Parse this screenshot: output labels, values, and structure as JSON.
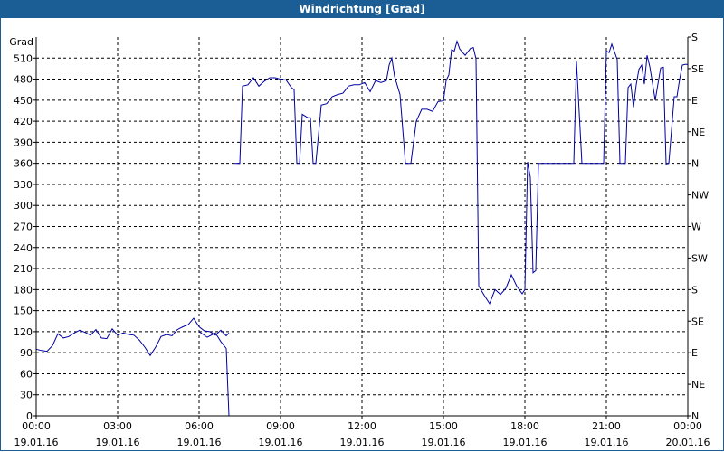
{
  "window": {
    "title": "Windrichtung [Grad]"
  },
  "colors": {
    "titlebar": "#1b5e95",
    "series": "#0000a0",
    "grid": "#000000"
  },
  "chart_data": {
    "type": "line",
    "title": "Windrichtung [Grad]",
    "ylabel": "Grad",
    "xlabel": "",
    "ylim": [
      0,
      540
    ],
    "xlim_hours": [
      0,
      24
    ],
    "y_ticks": [
      0,
      30,
      60,
      90,
      120,
      150,
      180,
      210,
      240,
      270,
      300,
      330,
      360,
      390,
      420,
      450,
      480,
      510
    ],
    "right_axis_labels": [
      {
        "value": 0,
        "label": "N"
      },
      {
        "value": 45,
        "label": "NE"
      },
      {
        "value": 90,
        "label": "E"
      },
      {
        "value": 135,
        "label": "SE"
      },
      {
        "value": 180,
        "label": "S"
      },
      {
        "value": 225,
        "label": "SW"
      },
      {
        "value": 270,
        "label": "W"
      },
      {
        "value": 315,
        "label": "NW"
      },
      {
        "value": 360,
        "label": "N"
      },
      {
        "value": 405,
        "label": "NE"
      },
      {
        "value": 450,
        "label": "E"
      },
      {
        "value": 495,
        "label": "SE"
      },
      {
        "value": 540,
        "label": "S"
      }
    ],
    "x_ticks": [
      {
        "hour": 0,
        "time": "00:00",
        "date": "19.01.16"
      },
      {
        "hour": 3,
        "time": "03:00",
        "date": "19.01.16"
      },
      {
        "hour": 6,
        "time": "06:00",
        "date": "19.01.16"
      },
      {
        "hour": 9,
        "time": "09:00",
        "date": "19.01.16"
      },
      {
        "hour": 12,
        "time": "12:00",
        "date": "19.01.16"
      },
      {
        "hour": 15,
        "time": "15:00",
        "date": "19.01.16"
      },
      {
        "hour": 18,
        "time": "18:00",
        "date": "19.01.16"
      },
      {
        "hour": 21,
        "time": "21:00",
        "date": "19.01.16"
      },
      {
        "hour": 24,
        "time": "00:00",
        "date": "20.01.16"
      }
    ],
    "grid": true,
    "legend": "none",
    "series": [
      {
        "segments": [
          {
            "hours": [
              0.0,
              0.2,
              0.4,
              0.6,
              0.8,
              1.0,
              1.2,
              1.4,
              1.6,
              1.8,
              2.0,
              2.2,
              2.4,
              2.6,
              2.8,
              3.0,
              3.2,
              3.4,
              3.6,
              3.8,
              4.0,
              4.2,
              4.4,
              4.6,
              4.8,
              5.0,
              5.2,
              5.4,
              5.6,
              5.8,
              6.0,
              6.2,
              6.4,
              6.6,
              6.8,
              7.0,
              7.1
            ],
            "values": [
              95,
              93,
              92,
              100,
              117,
              111,
              113,
              118,
              122,
              119,
              115,
              123,
              111,
              110,
              124,
              115,
              118,
              116,
              115,
              108,
              98,
              86,
              98,
              113,
              116,
              114,
              123,
              127,
              130,
              139,
              127,
              121,
              120,
              115,
              122,
              114,
              118
            ]
          },
          {
            "hours": [
              6.0,
              6.3,
              6.6,
              6.8,
              7.0,
              7.1
            ],
            "values": [
              120,
              112,
              118,
              106,
              96,
              0
            ]
          },
          {
            "hours": [
              7.3,
              7.5,
              7.6,
              7.8,
              8.0,
              8.2,
              8.4,
              8.6,
              8.8,
              9.0,
              9.2,
              9.4,
              9.5,
              9.6,
              9.7,
              9.8,
              10.0,
              10.1,
              10.2,
              10.3,
              10.5,
              10.7,
              10.9,
              11.1,
              11.3,
              11.5,
              11.7,
              11.9,
              12.1,
              12.3,
              12.5,
              12.7,
              12.9,
              13.0,
              13.1,
              13.2,
              13.4,
              13.6,
              13.8,
              14.0,
              14.2,
              14.4,
              14.6,
              14.8,
              15.0,
              15.1,
              15.2,
              15.3,
              15.4,
              15.5,
              15.6,
              15.8,
              16.0,
              16.1,
              16.2,
              16.3,
              16.5,
              16.7,
              16.9,
              17.1,
              17.3,
              17.5,
              17.7,
              17.9,
              18.0,
              18.1,
              18.2,
              18.3,
              18.4,
              18.5,
              18.6,
              18.7,
              18.8,
              19.0,
              19.2,
              19.4,
              19.6,
              19.8,
              19.9,
              20.1,
              20.3,
              20.5,
              20.7,
              20.9,
              21.0,
              21.1,
              21.2,
              21.3,
              21.4,
              21.5,
              21.6,
              21.7,
              21.8,
              21.9,
              22.0,
              22.1,
              22.2,
              22.3,
              22.4,
              22.5,
              22.6,
              22.8,
              23.0,
              23.1,
              23.2,
              23.3,
              23.5,
              23.6,
              23.7,
              23.8,
              23.9,
              24.0
            ],
            "values": [
              360,
              360,
              470,
              472,
              482,
              470,
              477,
              482,
              482,
              480,
              479,
              468,
              465,
              360,
              360,
              430,
              425,
              425,
              360,
              360,
              443,
              445,
              455,
              458,
              460,
              470,
              472,
              472,
              475,
              462,
              478,
              475,
              478,
              500,
              510,
              484,
              458,
              360,
              360,
              420,
              437,
              437,
              434,
              448,
              449,
              478,
              486,
              522,
              520,
              534,
              523,
              514,
              524,
              525,
              509,
              185,
              172,
              160,
              180,
              173,
              182,
              201,
              185,
              174,
              180,
              362,
              340,
              204,
              207,
              360,
              360,
              360,
              360,
              360,
              360,
              360,
              360,
              360,
              505,
              360,
              360,
              360,
              360,
              360,
              520,
              518,
              530,
              519,
              508,
              360,
              360,
              360,
              468,
              473,
              440,
              472,
              494,
              500,
              473,
              514,
              498,
              450,
              496,
              497,
              359,
              360,
              455,
              455,
              480,
              500,
              501,
              501
            ]
          }
        ]
      }
    ]
  }
}
